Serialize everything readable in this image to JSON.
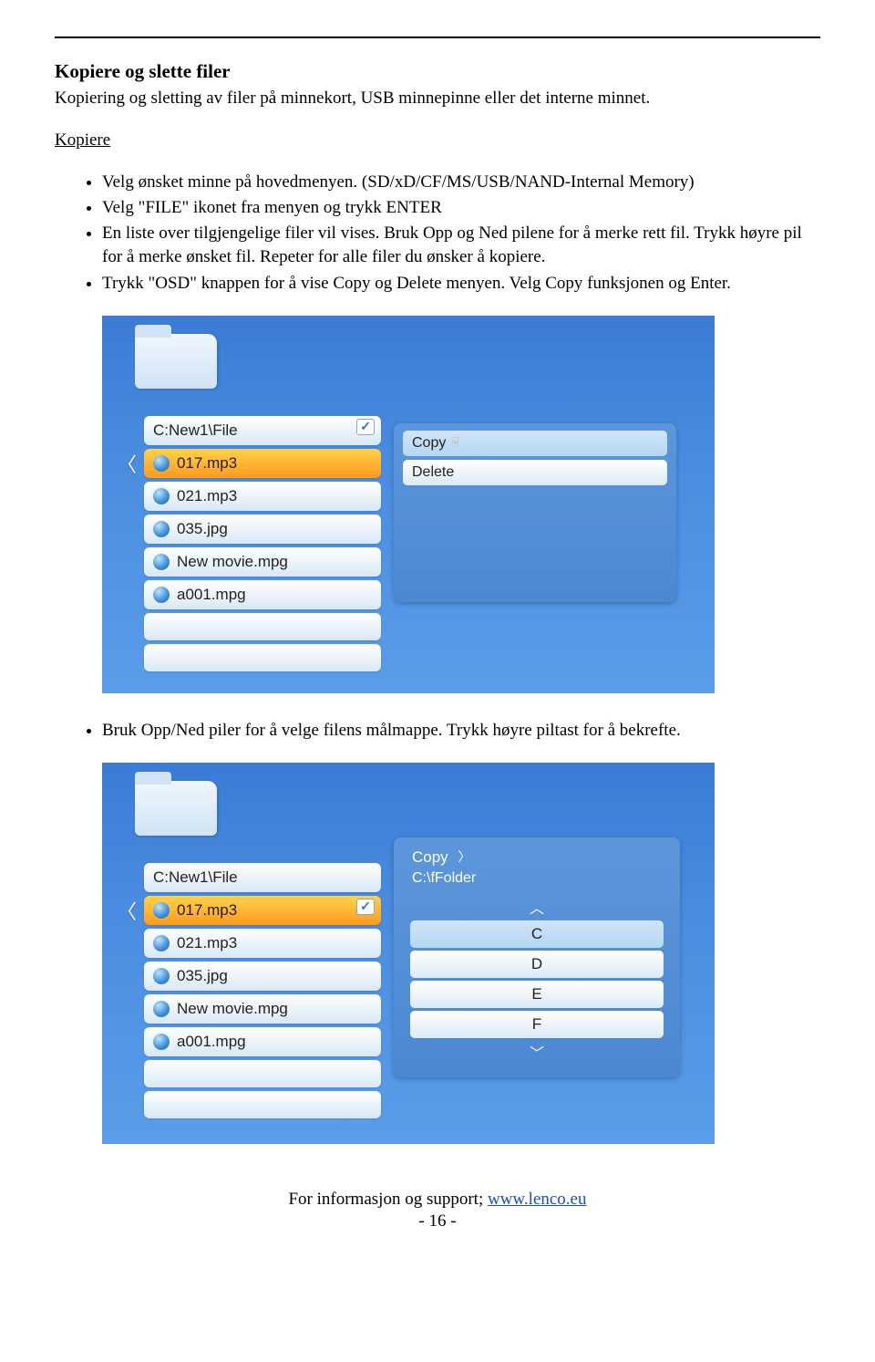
{
  "heading": "Kopiere og slette filer",
  "intro": "Kopiering og sletting av filer på minnekort, USB minnepinne eller det interne minnet.",
  "sectionLink": "Kopiere",
  "bullets1": [
    "Velg ønsket minne på hovedmenyen. (SD/xD/CF/MS/USB/NAND-Internal Memory)",
    "Velg \"FILE\" ikonet fra menyen og trykk ENTER",
    "En liste over tilgjengelige filer vil vises. Bruk Opp og Ned pilene for å merke rett fil. Trykk høyre pil for å merke ønsket fil. Repeter for alle filer du ønsker å kopiere.",
    "Trykk \"OSD\" knappen for å vise Copy og Delete menyen. Velg Copy funksjonen og Enter."
  ],
  "shot1": {
    "pathHeader": "C:New1\\File",
    "files": [
      "017.mp3",
      "021.mp3",
      "035.jpg",
      "New movie.mpg",
      "a001.mpg"
    ],
    "selectedIndex": 0,
    "checkedIndex": 0,
    "menu": [
      "Copy",
      "Delete"
    ],
    "menuSelected": 0
  },
  "bullets2": [
    "Bruk Opp/Ned piler for å velge filens målmappe. Trykk høyre piltast for å bekrefte."
  ],
  "shot2": {
    "pathHeader": "C:New1\\File",
    "files": [
      "017.mp3",
      "021.mp3",
      "035.jpg",
      "New movie.mpg",
      "a001.mpg"
    ],
    "selectedIndex": 0,
    "checkedIndex": 0,
    "popupTitle": "Copy",
    "popupPath": "C:\\fFolder",
    "drives": [
      "C",
      "D",
      "E",
      "F"
    ],
    "driveSelected": 0
  },
  "footerText": "For informasjon og support; ",
  "footerLink": "www.lenco.eu",
  "pageNum": "- 16 -"
}
